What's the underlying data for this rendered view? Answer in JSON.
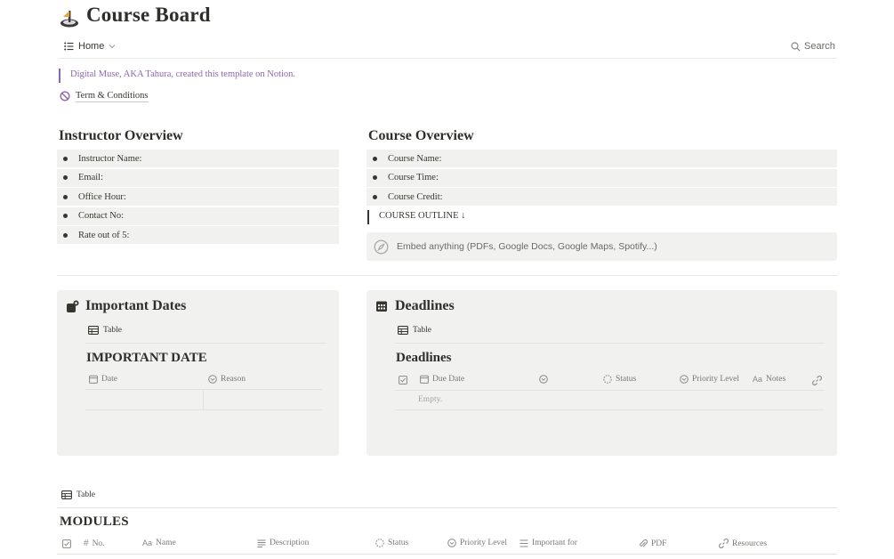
{
  "page": {
    "title": "Course Board",
    "icon": "sundial-icon"
  },
  "nav": {
    "home_label": "Home",
    "search_label": "Search"
  },
  "quote": {
    "text": "Digital Muse, AKA Tahura, created this template on Notion."
  },
  "terms_link": "Term & Conditions",
  "instructor": {
    "heading": "Instructor Overview",
    "fields": [
      "Instructor Name:",
      "Email:",
      "Office Hour:",
      "Contact No:",
      "Rate out of 5:"
    ]
  },
  "course": {
    "heading": "Course Overview",
    "fields": [
      "Course Name:",
      "Course Time:",
      "Course Credit:"
    ],
    "outline_label": "COURSE OUTLINE ↓",
    "embed_placeholder": "Embed anything (PDFs, Google Docs, Google Maps, Spotify...)"
  },
  "important_dates": {
    "title": "Important Dates",
    "view_label": "Table",
    "db_title": "IMPORTANT DATE",
    "columns": [
      "Date",
      "Reason"
    ]
  },
  "deadlines": {
    "title": "Deadlines",
    "view_label": "Table",
    "db_title": "Deadlines",
    "columns": [
      "Due Date",
      "",
      "Status",
      "Priority Level",
      "Notes"
    ],
    "empty_text": "Empty."
  },
  "modules": {
    "view_label": "Table",
    "db_title": "MODULES",
    "columns": [
      "No.",
      "Name",
      "Description",
      "Status",
      "Priority Level",
      "Important for",
      "PDF",
      "Resources"
    ]
  },
  "colors": {
    "quote_accent": "#9065b0",
    "callout_bg": "#f1f1ef",
    "text": "#37352f",
    "muted": "#787774"
  }
}
